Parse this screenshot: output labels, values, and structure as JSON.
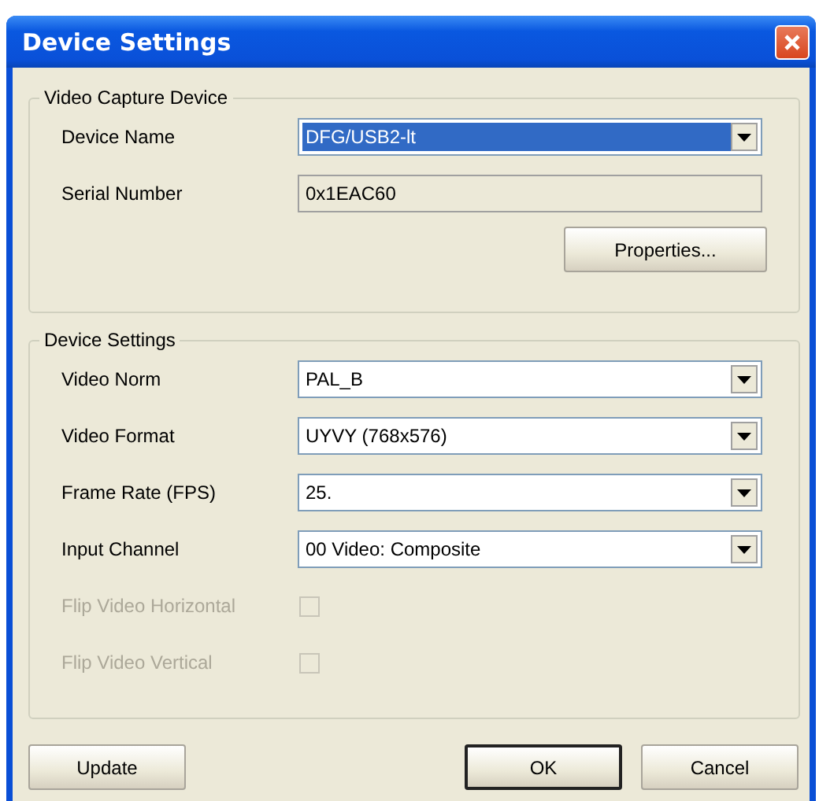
{
  "window": {
    "title": "Device Settings"
  },
  "groups": [
    {
      "title": "Video Capture Device",
      "rows": [
        {
          "kind": "dropdown",
          "label": "Device Name",
          "value": "DFG/USB2-lt",
          "selected": true
        },
        {
          "kind": "readonly",
          "label": "Serial Number",
          "value": "0x1EAC60"
        }
      ],
      "button": "Properties..."
    },
    {
      "title": "Device Settings",
      "rows": [
        {
          "kind": "dropdown",
          "label": "Video Norm",
          "value": "PAL_B",
          "selected": false
        },
        {
          "kind": "dropdown",
          "label": "Video Format",
          "value": "UYVY (768x576)",
          "selected": false
        },
        {
          "kind": "dropdown",
          "label": "Frame Rate (FPS)",
          "value": "25.",
          "selected": false
        },
        {
          "kind": "dropdown",
          "label": "Input Channel",
          "value": "00 Video: Composite",
          "selected": false
        },
        {
          "kind": "checkbox",
          "label": "Flip Video Horizontal",
          "checked": false,
          "disabled": true
        },
        {
          "kind": "checkbox",
          "label": "Flip Video Vertical",
          "checked": false,
          "disabled": true
        }
      ]
    }
  ],
  "buttons": [
    {
      "label": "Update",
      "default": false
    },
    {
      "label": "OK",
      "default": true
    },
    {
      "label": "Cancel",
      "default": false
    }
  ]
}
